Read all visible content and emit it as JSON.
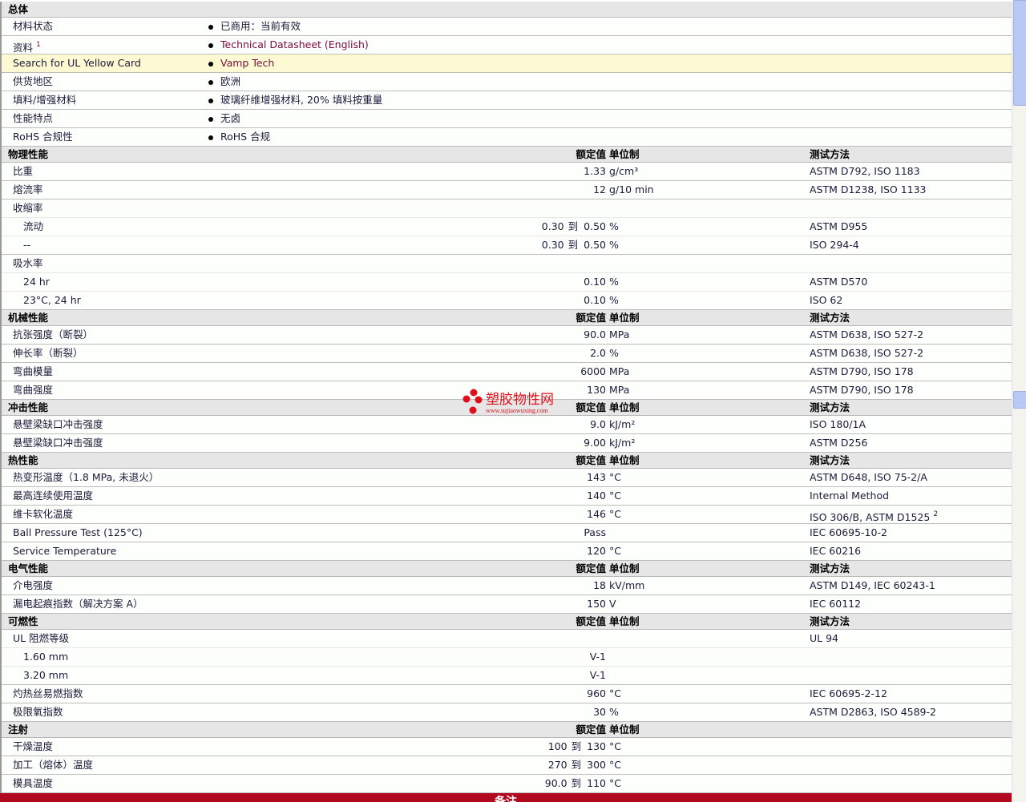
{
  "general": {
    "title": "总体",
    "rows": [
      {
        "label": "材料状态",
        "value": "已商用：当前有效"
      },
      {
        "label": "资料",
        "sup": "1",
        "value": "Technical Datasheet (English)",
        "link": true
      },
      {
        "label": "Search for UL Yellow Card",
        "value": "Vamp Tech",
        "link": true,
        "highlight": true
      },
      {
        "label": "供货地区",
        "value": "欧洲"
      },
      {
        "label": "填料/增强材料",
        "value": "玻璃纤维增强材料, 20% 填料按重量"
      },
      {
        "label": "性能特点",
        "value": "无卤"
      },
      {
        "label": "RoHS 合规性",
        "value": "RoHS 合规"
      }
    ]
  },
  "range_word": "到",
  "sections": [
    {
      "title": "物理性能",
      "h_value": "额定值",
      "h_unit": "单位制",
      "h_method": "测试方法",
      "rows": [
        {
          "label": "比重",
          "value": "1.33",
          "unit": "g/cm³",
          "method": "ASTM D792, ISO 1183"
        },
        {
          "label": "熔流率",
          "value": "12",
          "unit": "g/10 min",
          "method": "ASTM D1238, ISO 1133"
        },
        {
          "label": "收缩率",
          "group": true
        },
        {
          "label": "流动",
          "ind": true,
          "from": "0.30",
          "value": "0.50",
          "unit": "%",
          "method": "ASTM D955"
        },
        {
          "label": "--",
          "ind": true,
          "from": "0.30",
          "value": "0.50",
          "unit": "%",
          "method": "ISO 294-4"
        },
        {
          "label": "吸水率",
          "group": true
        },
        {
          "label": "24 hr",
          "ind": true,
          "value": "0.10",
          "unit": "%",
          "method": "ASTM D570"
        },
        {
          "label": "23°C, 24 hr",
          "ind": true,
          "value": "0.10",
          "unit": "%",
          "method": "ISO 62"
        }
      ]
    },
    {
      "title": "机械性能",
      "h_value": "额定值",
      "h_unit": "单位制",
      "h_method": "测试方法",
      "rows": [
        {
          "label": "抗张强度（断裂）",
          "value": "90.0",
          "unit": "MPa",
          "method": "ASTM D638, ISO 527-2"
        },
        {
          "label": "伸长率（断裂）",
          "value": "2.0",
          "unit": "%",
          "method": "ASTM D638, ISO 527-2"
        },
        {
          "label": "弯曲模量",
          "value": "6000",
          "unit": "MPa",
          "method": "ASTM D790, ISO 178"
        },
        {
          "label": "弯曲强度",
          "value": "130",
          "unit": "MPa",
          "method": "ASTM D790, ISO 178"
        }
      ]
    },
    {
      "title": "冲击性能",
      "h_value": "额定值",
      "h_unit": "单位制",
      "h_method": "测试方法",
      "rows": [
        {
          "label": "悬壁梁缺口冲击强度",
          "value": "9.0",
          "unit": "kJ/m²",
          "method": "ISO 180/1A"
        },
        {
          "label": "悬壁梁缺口冲击强度",
          "value": "9.00",
          "unit": "kJ/m²",
          "method": "ASTM D256"
        }
      ]
    },
    {
      "title": "热性能",
      "h_value": "额定值",
      "h_unit": "单位制",
      "h_method": "测试方法",
      "rows": [
        {
          "label": "热变形温度（1.8 MPa, 未退火）",
          "value": "143",
          "unit": "°C",
          "method": "ASTM D648, ISO 75-2/A"
        },
        {
          "label": "最高连续使用温度",
          "value": "140",
          "unit": "°C",
          "method": "Internal Method"
        },
        {
          "label": "维卡软化温度",
          "value": "146",
          "unit": "°C",
          "method": "ISO 306/B, ASTM D1525",
          "method_sup": "2"
        },
        {
          "label": "Ball Pressure Test (125°C)",
          "value": "Pass",
          "method": "IEC 60695-10-2"
        },
        {
          "label": "Service Temperature",
          "value": "120",
          "unit": "°C",
          "method": "IEC 60216"
        }
      ]
    },
    {
      "title": "电气性能",
      "h_value": "额定值",
      "h_unit": "单位制",
      "h_method": "测试方法",
      "rows": [
        {
          "label": "介电强度",
          "value": "18",
          "unit": "kV/mm",
          "method": "ASTM D149, IEC 60243-1"
        },
        {
          "label": "漏电起痕指数（解决方案 A）",
          "value": "150",
          "unit": "V",
          "method": "IEC 60112"
        }
      ]
    },
    {
      "title": "可燃性",
      "h_value": "额定值",
      "h_unit": "单位制",
      "h_method": "测试方法",
      "rows": [
        {
          "label": "UL 阻燃等级",
          "group": true,
          "method": "UL 94"
        },
        {
          "label": "1.60 mm",
          "ind": true,
          "value": "V-1"
        },
        {
          "label": "3.20 mm",
          "ind": true,
          "value": "V-1"
        },
        {
          "label": "灼热丝易燃指数",
          "value": "960",
          "unit": "°C",
          "method": "IEC 60695-2-12"
        },
        {
          "label": "极限氧指数",
          "value": "30",
          "unit": "%",
          "method": "ASTM D2863, ISO 4589-2"
        }
      ]
    },
    {
      "title": "注射",
      "h_value": "额定值",
      "h_unit": "单位制",
      "rows": [
        {
          "label": "干燥温度",
          "from": "100",
          "value": "130",
          "unit": "°C"
        },
        {
          "label": "加工（熔体）温度",
          "from": "270",
          "value": "300",
          "unit": "°C"
        },
        {
          "label": "模具温度",
          "from": "90.0",
          "value": "110",
          "unit": "°C"
        }
      ]
    }
  ],
  "footer": "备注",
  "watermark": {
    "name": "塑胶物性网",
    "url": "www.sujiaowuxing.com"
  }
}
